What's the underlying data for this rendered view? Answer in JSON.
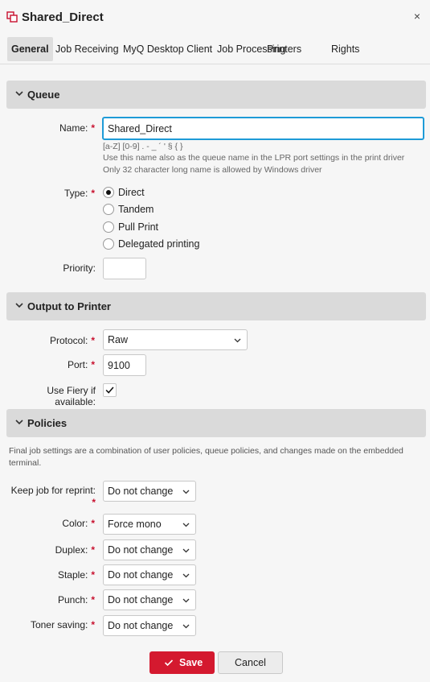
{
  "window": {
    "title": "Shared_Direct",
    "title_icon": "printer-queue-icon",
    "close_icon": "close-icon",
    "close_glyph": "×"
  },
  "tabs": [
    {
      "label": "General",
      "active": true
    },
    {
      "label": "Job Receiving"
    },
    {
      "label": "MyQ Desktop Client"
    },
    {
      "label": "Job Processing"
    },
    {
      "label": "Printers"
    },
    {
      "label": "Rights"
    }
  ],
  "required_mark": "*",
  "queue": {
    "header": "Queue",
    "name_label": "Name:",
    "name_value": "Shared_Direct",
    "hints": [
      "[a-Z] [0-9] . - _ ´ ' § { }",
      "Use this name also as the queue name in the LPR port settings in the print driver",
      "Only 32 character long name is allowed by Windows driver"
    ],
    "type_label": "Type:",
    "type_options": [
      "Direct",
      "Tandem",
      "Pull Print",
      "Delegated printing"
    ],
    "type_selected": "Direct",
    "priority_label": "Priority:",
    "priority_value": ""
  },
  "output": {
    "header": "Output to Printer",
    "protocol_label": "Protocol:",
    "protocol_value": "Raw",
    "port_label": "Port:",
    "port_value": "9100",
    "fiery_label": "Use Fiery if available:",
    "fiery_checked": true
  },
  "policies": {
    "header": "Policies",
    "description": "Final job settings are a combination of user policies, queue policies, and changes made on the embedded terminal.",
    "keep_label": "Keep job for reprint:",
    "keep_value": "Do not change",
    "color_label": "Color:",
    "color_value": "Force mono",
    "duplex_label": "Duplex:",
    "duplex_value": "Do not change",
    "staple_label": "Staple:",
    "staple_value": "Do not change",
    "punch_label": "Punch:",
    "punch_value": "Do not change",
    "toner_label": "Toner saving:",
    "toner_value": "Do not change"
  },
  "buttons": {
    "save": "Save",
    "cancel": "Cancel"
  },
  "colors": {
    "accent_red": "#d4192f",
    "focus_blue": "#1e9bd7",
    "section_bg": "#dadada"
  }
}
